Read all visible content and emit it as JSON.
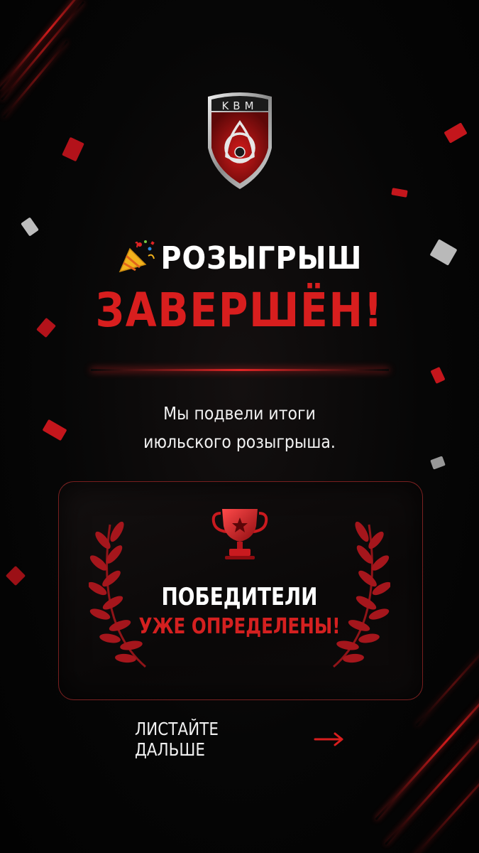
{
  "logo": {
    "text": "KBM",
    "icon": "kbm-shield-logo"
  },
  "headline": {
    "line1": "РОЗЫГРЫШ",
    "line2": "ЗАВЕРШЁН!",
    "emoji_icon": "party-popper-icon"
  },
  "subtitle": {
    "line1": "Мы подвели итоги",
    "line2": "июльского розыгрыша."
  },
  "winners_card": {
    "line1": "ПОБЕДИТЕЛИ",
    "line2": "УЖЕ ОПРЕДЕЛЕНЫ!",
    "icon": "trophy-icon"
  },
  "cta": {
    "label": "ЛИСТАЙТЕ ДАЛЬШЕ",
    "icon": "arrow-right-icon"
  },
  "colors": {
    "accent": "#d81e1e",
    "background": "#050505",
    "text": "#ffffff"
  }
}
